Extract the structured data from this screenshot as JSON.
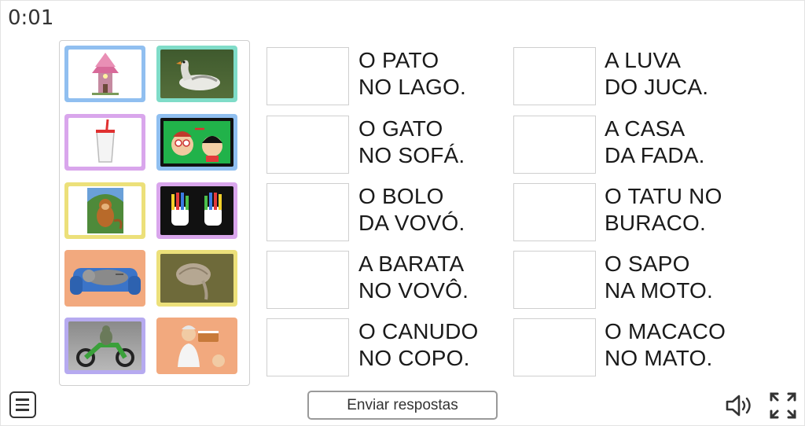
{
  "timer": "0:01",
  "cards": [
    {
      "name": "fairy-house-card",
      "border": "#90bff0",
      "subject": "fairy house"
    },
    {
      "name": "goose-lake-card",
      "border": "#7fdcc8",
      "subject": "goose on lake"
    },
    {
      "name": "cup-straw-card",
      "border": "#d9a6ec",
      "subject": "cup with straw"
    },
    {
      "name": "comic-kids-card",
      "border": "#90bff0",
      "subject": "comic characters"
    },
    {
      "name": "monkey-card",
      "border": "#ece07a",
      "subject": "monkey"
    },
    {
      "name": "painted-gloves-card",
      "border": "#d9a6ec",
      "subject": "colorful gloves"
    },
    {
      "name": "cat-sofa-card",
      "border": "#f2a97e",
      "subject": "cat on sofa"
    },
    {
      "name": "armadillo-card",
      "border": "#ece07a",
      "subject": "armadillo"
    },
    {
      "name": "frog-motorcycle-card",
      "border": "#b6aaf0",
      "subject": "frog on motorcycle"
    },
    {
      "name": "grandma-cake-card",
      "border": "#f2a97e",
      "subject": "grandma with cake"
    }
  ],
  "phrases": [
    {
      "l1": "O PATO",
      "l2": "NO LAGO."
    },
    {
      "l1": "A LUVA",
      "l2": "DO JUCA."
    },
    {
      "l1": "O GATO",
      "l2": "NO SOFÁ."
    },
    {
      "l1": "A CASA",
      "l2": "DA FADA."
    },
    {
      "l1": "O BOLO",
      "l2": "DA VOVÓ."
    },
    {
      "l1": "O TATU NO",
      "l2": "BURACO."
    },
    {
      "l1": "A BARATA",
      "l2": "NO VOVÔ."
    },
    {
      "l1": "O SAPO",
      "l2": "NA MOTO."
    },
    {
      "l1": "O CANUDO",
      "l2": "NO COPO."
    },
    {
      "l1": "O MACACO",
      "l2": "NO MATO."
    }
  ],
  "footer": {
    "submit_label": "Enviar respostas",
    "menu_icon": "menu-icon",
    "sound_icon": "speaker-icon",
    "fullscreen_icon": "fullscreen-icon"
  }
}
